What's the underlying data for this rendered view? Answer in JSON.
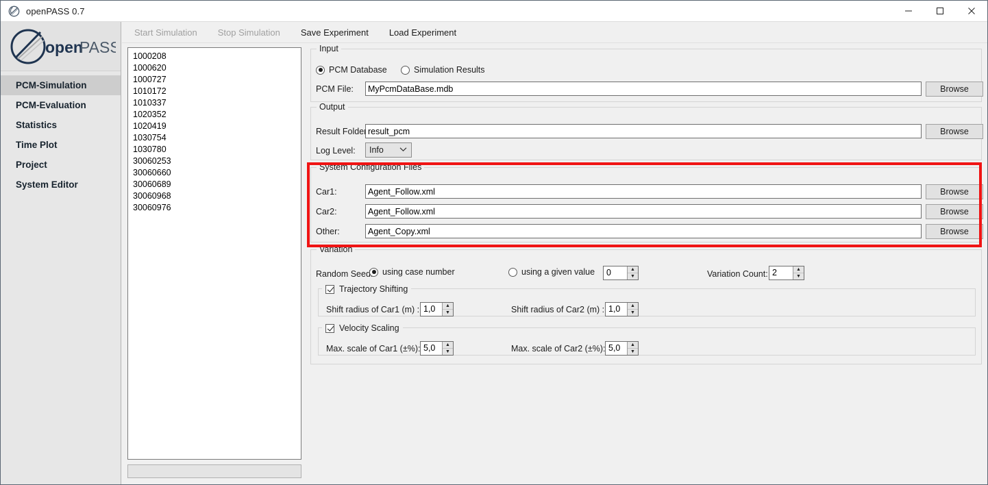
{
  "window": {
    "title": "openPASS 0.7",
    "app_icon": "openpass-logo-icon",
    "minimize_label": "—",
    "maximize_label": "☐",
    "close_label": "✕"
  },
  "sidebar": {
    "logo_text_bold": "open",
    "logo_text_light": "PASS",
    "items": [
      {
        "label": "PCM-Simulation",
        "active": true
      },
      {
        "label": "PCM-Evaluation",
        "active": false
      },
      {
        "label": "Statistics",
        "active": false
      },
      {
        "label": "Time Plot",
        "active": false
      },
      {
        "label": "Project",
        "active": false
      },
      {
        "label": "System Editor",
        "active": false
      }
    ]
  },
  "toolbar": {
    "items": [
      {
        "label": "Start Simulation",
        "enabled": false
      },
      {
        "label": "Stop Simulation",
        "enabled": false
      },
      {
        "label": "Save Experiment",
        "enabled": true
      },
      {
        "label": "Load Experiment",
        "enabled": true
      }
    ]
  },
  "case_list": {
    "items": [
      "1000208",
      "1000620",
      "1000727",
      "1010172",
      "1010337",
      "1020352",
      "1020419",
      "1030754",
      "1030780",
      "30060253",
      "30060660",
      "30060689",
      "30060968",
      "30060976"
    ]
  },
  "progress": {
    "value_label": ""
  },
  "input_group": {
    "title": "Input",
    "radio_pcm_database": "PCM Database",
    "radio_simulation_results": "Simulation Results",
    "selected": "PCM Database",
    "pcm_file_label": "PCM File:",
    "pcm_file_value": "MyPcmDataBase.mdb",
    "pcm_file_placeholder": "",
    "browse_label": "Browse"
  },
  "output_group": {
    "title": "Output",
    "result_folder_label": "Result Folder:",
    "result_folder_value": "result_pcm",
    "result_folder_placeholder": "",
    "browse_label": "Browse",
    "log_level_label": "Log Level:",
    "log_level_value": "Info",
    "log_level_options": [
      "Info"
    ]
  },
  "system_config_group": {
    "title": "System Configuration Files",
    "highlighted": true,
    "highlight_color": "#f01414",
    "rows": [
      {
        "label": "Car1:",
        "value": "Agent_Follow.xml",
        "browse_label": "Browse"
      },
      {
        "label": "Car2:",
        "value": "Agent_Follow.xml",
        "browse_label": "Browse"
      },
      {
        "label": "Other:",
        "value": "Agent_Copy.xml",
        "browse_label": "Browse"
      }
    ]
  },
  "variation_group": {
    "title": "Variation",
    "random_seed_label": "Random Seed:",
    "seed_case_number_label": "using case number",
    "seed_given_value_label": "using a given value",
    "seed_selected": "using case number",
    "seed_given_value": "0",
    "variation_count_label": "Variation Count:",
    "variation_count_value": "2",
    "trajectory": {
      "title": "Trajectory Shifting",
      "checked": true,
      "car1_label": "Shift radius of Car1 (m) :",
      "car1_value": "1,0",
      "car2_label": "Shift radius of Car2 (m) :",
      "car2_value": "1,0"
    },
    "velocity": {
      "title": "Velocity Scaling",
      "checked": true,
      "car1_label": "Max. scale of Car1 (±%):",
      "car1_value": "5,0",
      "car2_label": "Max. scale of Car2 (±%):",
      "car2_value": "5,0"
    }
  },
  "icons": {
    "spin_up": "▲",
    "spin_down": "▼",
    "combo_arrow": "⌄"
  }
}
